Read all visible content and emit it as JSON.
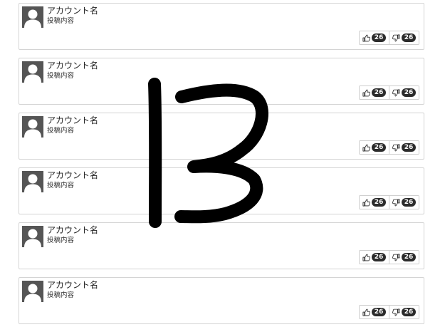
{
  "posts": [
    {
      "account_name": "アカウント名",
      "content": "投稿内容",
      "likes": "26",
      "dislikes": "26"
    },
    {
      "account_name": "アカウント名",
      "content": "投稿内容",
      "likes": "26",
      "dislikes": "26"
    },
    {
      "account_name": "アカウント名",
      "content": "投稿内容",
      "likes": "26",
      "dislikes": "26"
    },
    {
      "account_name": "アカウント名",
      "content": "投稿内容",
      "likes": "26",
      "dislikes": "26"
    },
    {
      "account_name": "アカウント名",
      "content": "投稿内容",
      "likes": "26",
      "dislikes": "26"
    },
    {
      "account_name": "アカウント名",
      "content": "投稿内容",
      "likes": "26",
      "dislikes": "26"
    }
  ],
  "icons": {
    "avatar": "user-avatar-icon",
    "like": "thumbs-up-icon",
    "dislike": "thumbs-down-icon"
  },
  "annotation": {
    "text": "13"
  },
  "colors": {
    "avatar_bg": "#555555",
    "badge_bg": "#2b2b2b",
    "border": "#d4d4d4"
  }
}
